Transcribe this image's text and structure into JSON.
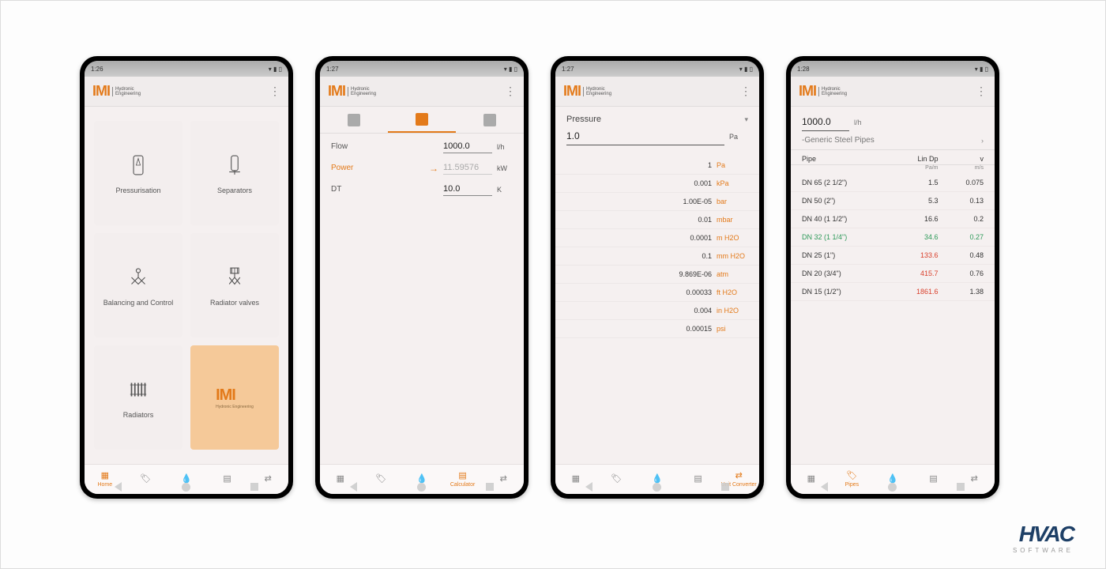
{
  "brand": {
    "name": "IMI",
    "sub1": "Hydronic",
    "sub2": "Engineering"
  },
  "status": {
    "time1": "1:26",
    "time2": "1:27",
    "time3": "1:27",
    "time4": "1:28"
  },
  "screen1": {
    "tiles": [
      {
        "label": "Pressurisation"
      },
      {
        "label": "Separators"
      },
      {
        "label": "Balancing and Control"
      },
      {
        "label": "Radiator valves"
      },
      {
        "label": "Radiators"
      },
      {
        "label": ""
      }
    ],
    "nav": {
      "home": "Home"
    }
  },
  "screen2": {
    "rows": {
      "flow": {
        "label": "Flow",
        "value": "1000.0",
        "unit": "l/h"
      },
      "power": {
        "label": "Power",
        "value": "11.59576",
        "unit": "kW"
      },
      "dt": {
        "label": "DT",
        "value": "10.0",
        "unit": "K"
      }
    },
    "nav": {
      "calculator": "Calculator"
    }
  },
  "screen3": {
    "category": "Pressure",
    "input": {
      "value": "1.0",
      "unit": "Pa"
    },
    "conversions": [
      {
        "v": "1",
        "u": "Pa"
      },
      {
        "v": "0.001",
        "u": "kPa"
      },
      {
        "v": "1.00E-05",
        "u": "bar"
      },
      {
        "v": "0.01",
        "u": "mbar"
      },
      {
        "v": "0.0001",
        "u": "m H2O"
      },
      {
        "v": "0.1",
        "u": "mm H2O"
      },
      {
        "v": "9.869E-06",
        "u": "atm"
      },
      {
        "v": "0.00033",
        "u": "ft H2O"
      },
      {
        "v": "0.004",
        "u": "in H2O"
      },
      {
        "v": "0.00015",
        "u": "psi"
      }
    ],
    "nav": {
      "uc": "Unit Converter"
    }
  },
  "screen4": {
    "input": {
      "value": "1000.0",
      "unit": "l/h"
    },
    "pipeset": "-Generic Steel Pipes",
    "head": {
      "c1": "Pipe",
      "c2": "Lin Dp",
      "c3": "v",
      "u2": "Pa/m",
      "u3": "m/s"
    },
    "rows": [
      {
        "n": "DN 65 (2 1/2\")",
        "dp": "1.5",
        "v": "0.075",
        "style": ""
      },
      {
        "n": "DN 50 (2\")",
        "dp": "5.3",
        "v": "0.13",
        "style": ""
      },
      {
        "n": "DN 40 (1 1/2\")",
        "dp": "16.6",
        "v": "0.2",
        "style": ""
      },
      {
        "n": "DN 32 (1 1/4\")",
        "dp": "34.6",
        "v": "0.27",
        "style": "green"
      },
      {
        "n": "DN 25 (1\")",
        "dp": "133.6",
        "v": "0.48",
        "style": "redp"
      },
      {
        "n": "DN 20 (3/4\")",
        "dp": "415.7",
        "v": "0.76",
        "style": "redp"
      },
      {
        "n": "DN 15 (1/2\")",
        "dp": "1861.6",
        "v": "1.38",
        "style": "redp"
      }
    ],
    "nav": {
      "pipes": "Pipes"
    }
  },
  "footer": {
    "big": "HVAC",
    "small": "SOFTWARE"
  }
}
